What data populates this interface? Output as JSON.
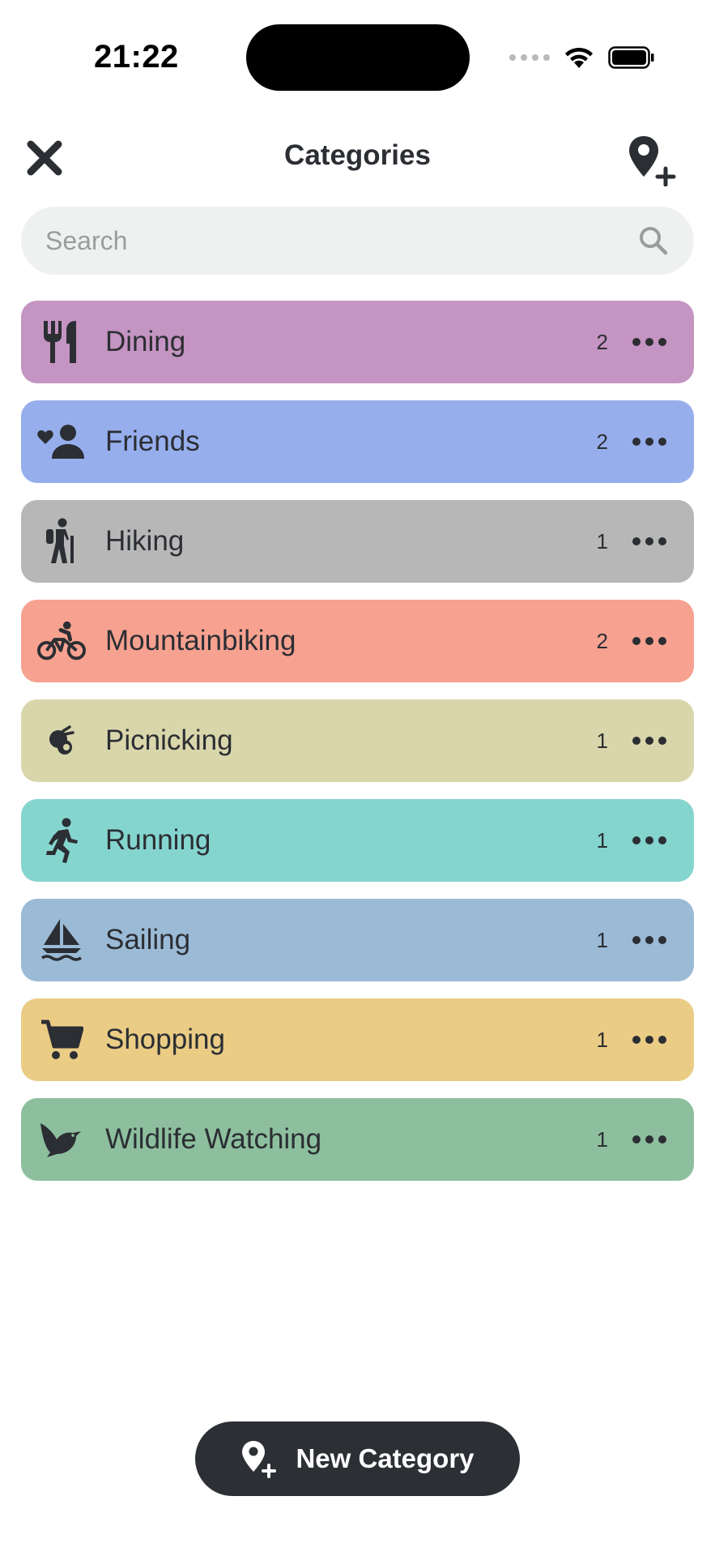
{
  "status_bar": {
    "time": "21:22"
  },
  "header": {
    "title": "Categories",
    "close_icon": "close-icon",
    "add_place_icon": "map-pin-plus-icon"
  },
  "search": {
    "placeholder": "Search",
    "value": "",
    "icon": "search-icon"
  },
  "categories": [
    {
      "label": "Dining",
      "count": "2",
      "color": "#c494c2",
      "icon": "fork-knife-icon"
    },
    {
      "label": "Friends",
      "count": "2",
      "color": "#97aeed",
      "icon": "friends-heart-icon"
    },
    {
      "label": "Hiking",
      "count": "1",
      "color": "#b7b7b7",
      "icon": "hiker-icon"
    },
    {
      "label": "Mountainbiking",
      "count": "2",
      "color": "#f7a190",
      "icon": "bicycle-icon"
    },
    {
      "label": "Picnicking",
      "count": "1",
      "color": "#d9d6ab",
      "icon": "picnic-icon"
    },
    {
      "label": "Running",
      "count": "1",
      "color": "#85d5cf",
      "icon": "runner-icon"
    },
    {
      "label": "Sailing",
      "count": "1",
      "color": "#9bbad6",
      "icon": "sailboat-icon"
    },
    {
      "label": "Shopping",
      "count": "1",
      "color": "#eacc85",
      "icon": "shopping-cart-icon"
    },
    {
      "label": "Wildlife Watching",
      "count": "1",
      "color": "#8dbf9e",
      "icon": "bird-icon"
    }
  ],
  "new_category": {
    "label": "New Category",
    "icon": "map-pin-plus-icon"
  }
}
